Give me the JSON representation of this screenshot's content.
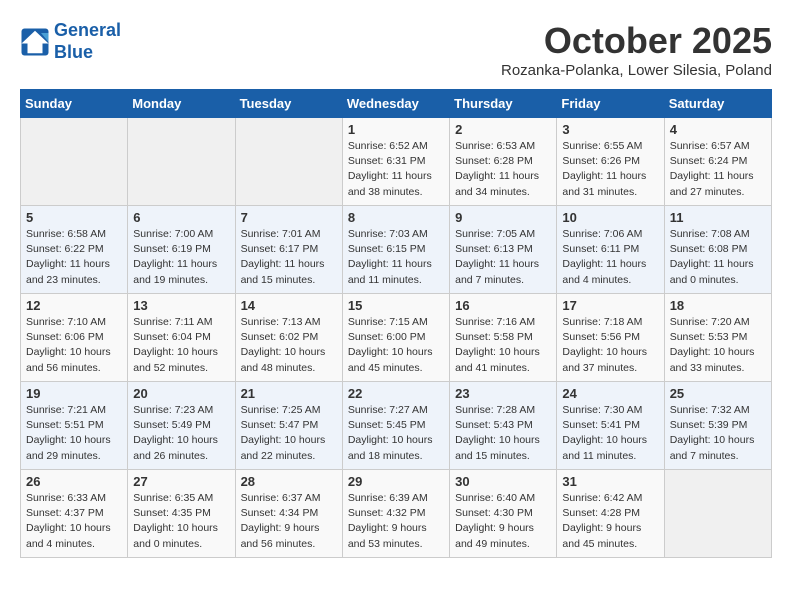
{
  "header": {
    "logo_line1": "General",
    "logo_line2": "Blue",
    "month": "October 2025",
    "location": "Rozanka-Polanka, Lower Silesia, Poland"
  },
  "weekdays": [
    "Sunday",
    "Monday",
    "Tuesday",
    "Wednesday",
    "Thursday",
    "Friday",
    "Saturday"
  ],
  "weeks": [
    [
      {
        "day": "",
        "content": ""
      },
      {
        "day": "",
        "content": ""
      },
      {
        "day": "",
        "content": ""
      },
      {
        "day": "1",
        "content": "Sunrise: 6:52 AM\nSunset: 6:31 PM\nDaylight: 11 hours\nand 38 minutes."
      },
      {
        "day": "2",
        "content": "Sunrise: 6:53 AM\nSunset: 6:28 PM\nDaylight: 11 hours\nand 34 minutes."
      },
      {
        "day": "3",
        "content": "Sunrise: 6:55 AM\nSunset: 6:26 PM\nDaylight: 11 hours\nand 31 minutes."
      },
      {
        "day": "4",
        "content": "Sunrise: 6:57 AM\nSunset: 6:24 PM\nDaylight: 11 hours\nand 27 minutes."
      }
    ],
    [
      {
        "day": "5",
        "content": "Sunrise: 6:58 AM\nSunset: 6:22 PM\nDaylight: 11 hours\nand 23 minutes."
      },
      {
        "day": "6",
        "content": "Sunrise: 7:00 AM\nSunset: 6:19 PM\nDaylight: 11 hours\nand 19 minutes."
      },
      {
        "day": "7",
        "content": "Sunrise: 7:01 AM\nSunset: 6:17 PM\nDaylight: 11 hours\nand 15 minutes."
      },
      {
        "day": "8",
        "content": "Sunrise: 7:03 AM\nSunset: 6:15 PM\nDaylight: 11 hours\nand 11 minutes."
      },
      {
        "day": "9",
        "content": "Sunrise: 7:05 AM\nSunset: 6:13 PM\nDaylight: 11 hours\nand 7 minutes."
      },
      {
        "day": "10",
        "content": "Sunrise: 7:06 AM\nSunset: 6:11 PM\nDaylight: 11 hours\nand 4 minutes."
      },
      {
        "day": "11",
        "content": "Sunrise: 7:08 AM\nSunset: 6:08 PM\nDaylight: 11 hours\nand 0 minutes."
      }
    ],
    [
      {
        "day": "12",
        "content": "Sunrise: 7:10 AM\nSunset: 6:06 PM\nDaylight: 10 hours\nand 56 minutes."
      },
      {
        "day": "13",
        "content": "Sunrise: 7:11 AM\nSunset: 6:04 PM\nDaylight: 10 hours\nand 52 minutes."
      },
      {
        "day": "14",
        "content": "Sunrise: 7:13 AM\nSunset: 6:02 PM\nDaylight: 10 hours\nand 48 minutes."
      },
      {
        "day": "15",
        "content": "Sunrise: 7:15 AM\nSunset: 6:00 PM\nDaylight: 10 hours\nand 45 minutes."
      },
      {
        "day": "16",
        "content": "Sunrise: 7:16 AM\nSunset: 5:58 PM\nDaylight: 10 hours\nand 41 minutes."
      },
      {
        "day": "17",
        "content": "Sunrise: 7:18 AM\nSunset: 5:56 PM\nDaylight: 10 hours\nand 37 minutes."
      },
      {
        "day": "18",
        "content": "Sunrise: 7:20 AM\nSunset: 5:53 PM\nDaylight: 10 hours\nand 33 minutes."
      }
    ],
    [
      {
        "day": "19",
        "content": "Sunrise: 7:21 AM\nSunset: 5:51 PM\nDaylight: 10 hours\nand 29 minutes."
      },
      {
        "day": "20",
        "content": "Sunrise: 7:23 AM\nSunset: 5:49 PM\nDaylight: 10 hours\nand 26 minutes."
      },
      {
        "day": "21",
        "content": "Sunrise: 7:25 AM\nSunset: 5:47 PM\nDaylight: 10 hours\nand 22 minutes."
      },
      {
        "day": "22",
        "content": "Sunrise: 7:27 AM\nSunset: 5:45 PM\nDaylight: 10 hours\nand 18 minutes."
      },
      {
        "day": "23",
        "content": "Sunrise: 7:28 AM\nSunset: 5:43 PM\nDaylight: 10 hours\nand 15 minutes."
      },
      {
        "day": "24",
        "content": "Sunrise: 7:30 AM\nSunset: 5:41 PM\nDaylight: 10 hours\nand 11 minutes."
      },
      {
        "day": "25",
        "content": "Sunrise: 7:32 AM\nSunset: 5:39 PM\nDaylight: 10 hours\nand 7 minutes."
      }
    ],
    [
      {
        "day": "26",
        "content": "Sunrise: 6:33 AM\nSunset: 4:37 PM\nDaylight: 10 hours\nand 4 minutes."
      },
      {
        "day": "27",
        "content": "Sunrise: 6:35 AM\nSunset: 4:35 PM\nDaylight: 10 hours\nand 0 minutes."
      },
      {
        "day": "28",
        "content": "Sunrise: 6:37 AM\nSunset: 4:34 PM\nDaylight: 9 hours\nand 56 minutes."
      },
      {
        "day": "29",
        "content": "Sunrise: 6:39 AM\nSunset: 4:32 PM\nDaylight: 9 hours\nand 53 minutes."
      },
      {
        "day": "30",
        "content": "Sunrise: 6:40 AM\nSunset: 4:30 PM\nDaylight: 9 hours\nand 49 minutes."
      },
      {
        "day": "31",
        "content": "Sunrise: 6:42 AM\nSunset: 4:28 PM\nDaylight: 9 hours\nand 45 minutes."
      },
      {
        "day": "",
        "content": ""
      }
    ]
  ]
}
